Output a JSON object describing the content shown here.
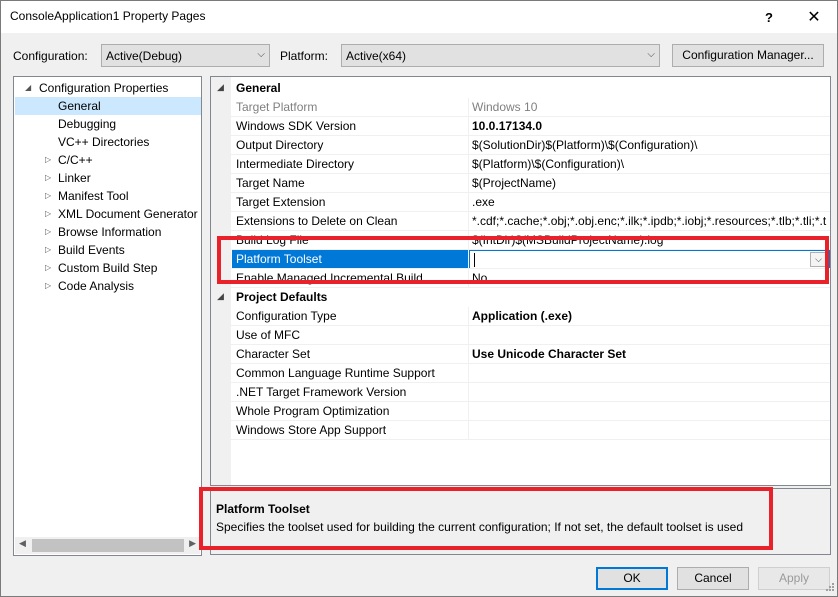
{
  "window": {
    "title": "ConsoleApplication1 Property Pages",
    "help_glyph": "?",
    "close_glyph": "✕"
  },
  "toolbar": {
    "configuration_label": "Configuration:",
    "configuration_value": "Active(Debug)",
    "platform_label": "Platform:",
    "platform_value": "Active(x64)",
    "config_manager_label": "Configuration Manager..."
  },
  "tree": {
    "root": "Configuration Properties",
    "items": [
      {
        "label": "General",
        "expandable": false,
        "selected": true
      },
      {
        "label": "Debugging",
        "expandable": false
      },
      {
        "label": "VC++ Directories",
        "expandable": false
      },
      {
        "label": "C/C++",
        "expandable": true
      },
      {
        "label": "Linker",
        "expandable": true
      },
      {
        "label": "Manifest Tool",
        "expandable": true
      },
      {
        "label": "XML Document Generator",
        "expandable": true
      },
      {
        "label": "Browse Information",
        "expandable": true
      },
      {
        "label": "Build Events",
        "expandable": true
      },
      {
        "label": "Custom Build Step",
        "expandable": true
      },
      {
        "label": "Code Analysis",
        "expandable": true
      }
    ]
  },
  "grid": {
    "general_header": "General",
    "general_rows": [
      {
        "name": "Target Platform",
        "value": "Windows 10",
        "style": "dim"
      },
      {
        "name": "Windows SDK Version",
        "value": "10.0.17134.0",
        "style": "bold"
      },
      {
        "name": "Output Directory",
        "value": "$(SolutionDir)$(Platform)\\$(Configuration)\\",
        "style": ""
      },
      {
        "name": "Intermediate Directory",
        "value": "$(Platform)\\$(Configuration)\\",
        "style": ""
      },
      {
        "name": "Target Name",
        "value": "$(ProjectName)",
        "style": ""
      },
      {
        "name": "Target Extension",
        "value": ".exe",
        "style": ""
      },
      {
        "name": "Extensions to Delete on Clean",
        "value": "*.cdf;*.cache;*.obj;*.obj.enc;*.ilk;*.ipdb;*.iobj;*.resources;*.tlb;*.tli;*.t",
        "style": ""
      },
      {
        "name": "Build Log File",
        "value": "$(IntDir)$(MSBuildProjectName).log",
        "style": ""
      },
      {
        "name": "Platform Toolset",
        "value": "",
        "style": "selected"
      },
      {
        "name": "Enable Managed Incremental Build",
        "value": "No",
        "style": ""
      }
    ],
    "defaults_header": "Project Defaults",
    "defaults_rows": [
      {
        "name": "Configuration Type",
        "value": "Application (.exe)",
        "style": "bold"
      },
      {
        "name": "Use of MFC",
        "value": "",
        "style": ""
      },
      {
        "name": "Character Set",
        "value": "Use Unicode Character Set",
        "style": "bold"
      },
      {
        "name": "Common Language Runtime Support",
        "value": "",
        "style": ""
      },
      {
        "name": ".NET Target Framework Version",
        "value": "",
        "style": ""
      },
      {
        "name": "Whole Program Optimization",
        "value": "",
        "style": ""
      },
      {
        "name": "Windows Store App Support",
        "value": "",
        "style": ""
      }
    ]
  },
  "description": {
    "title": "Platform Toolset",
    "text": "Specifies the toolset used for building the current configuration; If not set, the default toolset is used"
  },
  "buttons": {
    "ok": "OK",
    "cancel": "Cancel",
    "apply": "Apply"
  },
  "colors": {
    "highlight": "#e8212b",
    "selection": "#0078d7",
    "tree_selection": "#cce8ff"
  }
}
